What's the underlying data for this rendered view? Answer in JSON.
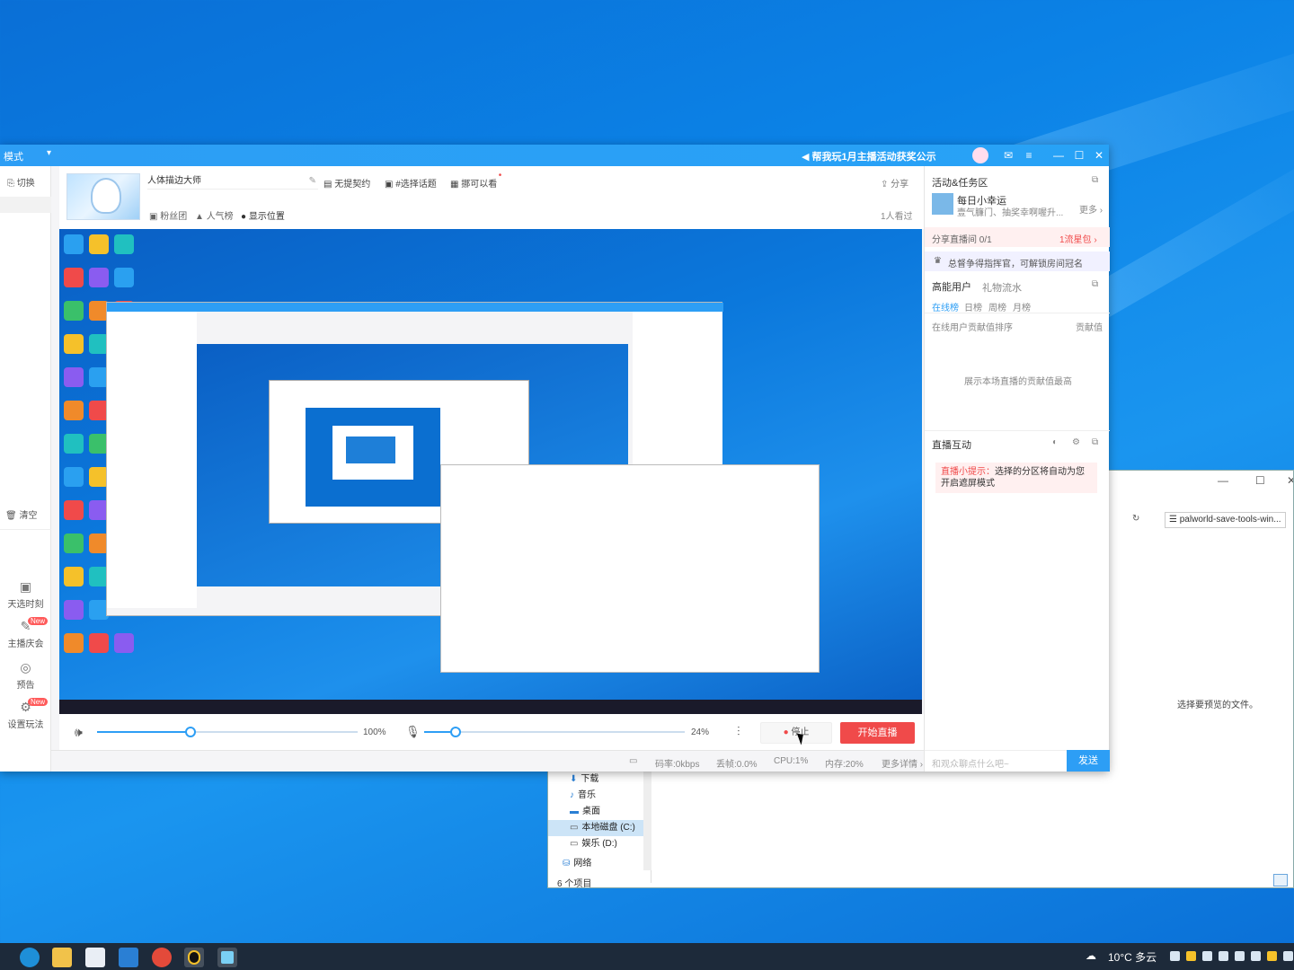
{
  "desktop": {
    "background": "#0b82e6"
  },
  "explorer": {
    "address": "palworld-save-tools-win...",
    "nav_items": [
      {
        "label": "下载",
        "icon": "download-icon"
      },
      {
        "label": "音乐",
        "icon": "music-icon"
      },
      {
        "label": "桌面",
        "icon": "desktop-icon"
      },
      {
        "label": "本地磁盘 (C:)",
        "icon": "drive-icon"
      },
      {
        "label": "娱乐 (D:)",
        "icon": "drive-icon"
      },
      {
        "label": "网络",
        "icon": "network-icon"
      }
    ],
    "preview_text": "选择要预览的文件。",
    "status": "6 个项目"
  },
  "app": {
    "title_mode": "模式",
    "notice": "帮我玩1月主播活动获奖公示",
    "left_nav": {
      "switch": "切换",
      "clear": "清空",
      "items": [
        {
          "label": "天选时刻",
          "icon": "gift-icon",
          "new": ""
        },
        {
          "label": "主播庆会",
          "icon": "pen-icon",
          "new": "New"
        },
        {
          "label": "预告",
          "icon": "clock-icon",
          "new": ""
        },
        {
          "label": "设置玩法",
          "icon": "settings-icon",
          "new": "New"
        }
      ]
    },
    "header": {
      "room_title": "人体描边大师",
      "no_contract": "无提契约",
      "topic": "#选择话题",
      "permission": "挪可以看",
      "share": "分享",
      "fans": "粉丝团",
      "popularity": "人气榜",
      "show_location": "显示位置",
      "viewers": "1人看过"
    },
    "controls": {
      "volume_pct": "100%",
      "mic_pct": "24%",
      "volume_level": 0.36,
      "mic_level": 0.12,
      "stop": "停止",
      "go_live": "开始直播"
    },
    "status": {
      "bitrate": "码率:0kbps",
      "frame_drop": "丢帧:0.0%",
      "cpu": "CPU:1%",
      "memory": "内存:20%",
      "more": "更多详情"
    },
    "right_panel": {
      "activity_title": "活动&任务区",
      "daily_title": "每日小幸运",
      "daily_sub": "壹气臁门、抽奖幸啊喔升...",
      "more": "更多",
      "share_room": "分享直播间",
      "share_count": "0/1",
      "share_reward": "1流星包",
      "commander": "总督争得指挥官，可解锁房间冠名",
      "users_title": "高能用户",
      "gift_flow": "礼物流水",
      "tabs": [
        "在线榜",
        "日榜",
        "周榜",
        "月榜"
      ],
      "online_sort": "在线用户贡献值排序",
      "contribution": "贡献值",
      "empty_rank": "展示本场直播的贡献值最高",
      "interact_title": "直播互动",
      "tip_label": "直播小提示：",
      "tip_text": "选择的分区将自动为您开启遮屏模式",
      "chat_placeholder": "和观众聊点什么吧~",
      "send": "发送"
    }
  },
  "taskbar": {
    "weather": "10°C 多云",
    "apps": [
      "edge-icon",
      "folder-icon",
      "store-icon",
      "mail-icon",
      "chrome-icon",
      "qq-icon",
      "live-app-icon"
    ]
  }
}
